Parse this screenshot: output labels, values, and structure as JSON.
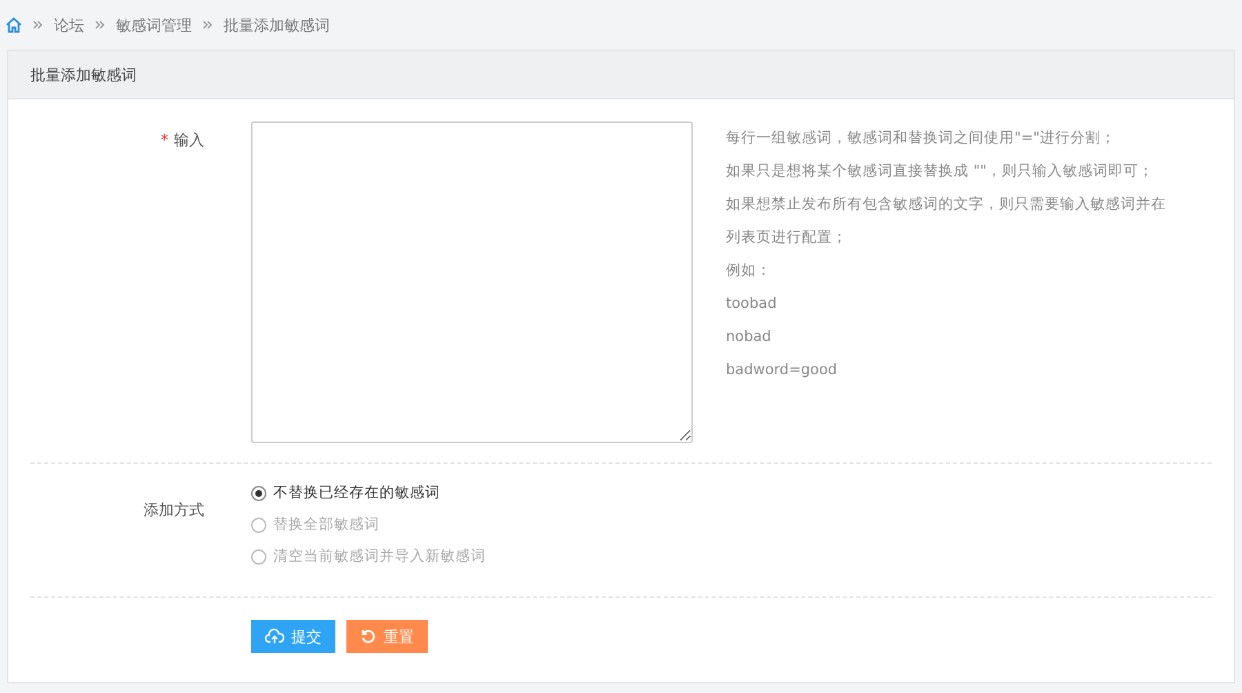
{
  "breadcrumb": [
    "论坛",
    "敏感词管理",
    "批量添加敏感词"
  ],
  "panel": {
    "title": "批量添加敏感词"
  },
  "input_field": {
    "label": "输入",
    "required_mark": "*"
  },
  "help_lines": [
    "每行一组敏感词，敏感词和替换词之间使用\"=\"进行分割；",
    "如果只是想将某个敏感词直接替换成 \"\"，则只输入敏感词即可；",
    "如果想禁止发布所有包含敏感词的文字，则只需要输入敏感词并在",
    "列表页进行配置；",
    "例如：",
    "toobad",
    "nobad",
    "badword=good"
  ],
  "add_mode": {
    "label": "添加方式",
    "options": [
      {
        "label": "不替换已经存在的敏感词",
        "selected": true
      },
      {
        "label": "替换全部敏感词",
        "selected": false
      },
      {
        "label": "清空当前敏感词并导入新敏感词",
        "selected": false
      }
    ]
  },
  "buttons": [
    {
      "kind": "submit",
      "label": "提交"
    },
    {
      "kind": "reset",
      "label": "重置"
    }
  ]
}
